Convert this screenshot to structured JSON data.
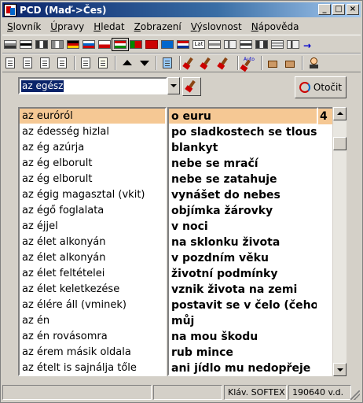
{
  "window": {
    "title": "PCD (Maď->Čes)"
  },
  "menu": [
    {
      "accel": "S",
      "rest": "lovník"
    },
    {
      "accel": "Ú",
      "rest": "pravy"
    },
    {
      "accel": "H",
      "rest": "ledat"
    },
    {
      "accel": "Z",
      "rest": "obrazení"
    },
    {
      "accel": "V",
      "rest": "ýslovnost"
    },
    {
      "accel": "N",
      "rest": "ápověda"
    }
  ],
  "search": {
    "value": "az egész"
  },
  "buttons": {
    "otocit": "Otočit"
  },
  "entries": [
    {
      "hu": "az euróról",
      "cs": "o euru"
    },
    {
      "hu": "az édesség hizlal",
      "cs": "po sladkostech se tloustn"
    },
    {
      "hu": "az ég azúrja",
      "cs": "blankyt"
    },
    {
      "hu": "az ég elborult",
      "cs": "nebe se mračí"
    },
    {
      "hu": "az ég elborult",
      "cs": "nebe se zatahuje"
    },
    {
      "hu": "az égig magasztal (vkit)",
      "cs": "vynášet do nebes"
    },
    {
      "hu": "az égő foglalata",
      "cs": "objímka žárovky"
    },
    {
      "hu": "az éjjel",
      "cs": "v noci"
    },
    {
      "hu": "az élet alkonyán",
      "cs": "na sklonku života"
    },
    {
      "hu": "az élet alkonyán",
      "cs": "v pozdním věku"
    },
    {
      "hu": "az élet feltételei",
      "cs": "životní podmínky"
    },
    {
      "hu": "az élet keletkezése",
      "cs": "vznik života na zemi"
    },
    {
      "hu": "az élére áll (vminek)",
      "cs": "postavit se v čelo (čeho)"
    },
    {
      "hu": "az én",
      "cs": "můj"
    },
    {
      "hu": "az én rovásomra",
      "cs": "na mou škodu"
    },
    {
      "hu": "az érem másik oldala",
      "cs": "rub mince"
    },
    {
      "hu": "az ételt is sajnálja tőle",
      "cs": "ani jídlo mu nedopřeje"
    }
  ],
  "selected_count": "4",
  "status": {
    "pane1": "",
    "pane2": "",
    "keyboard": "Kláv. SOFTEX",
    "count": "190640 v.d."
  },
  "colors": {
    "selection": "#f5c894",
    "titlebar": "#0a246a"
  }
}
